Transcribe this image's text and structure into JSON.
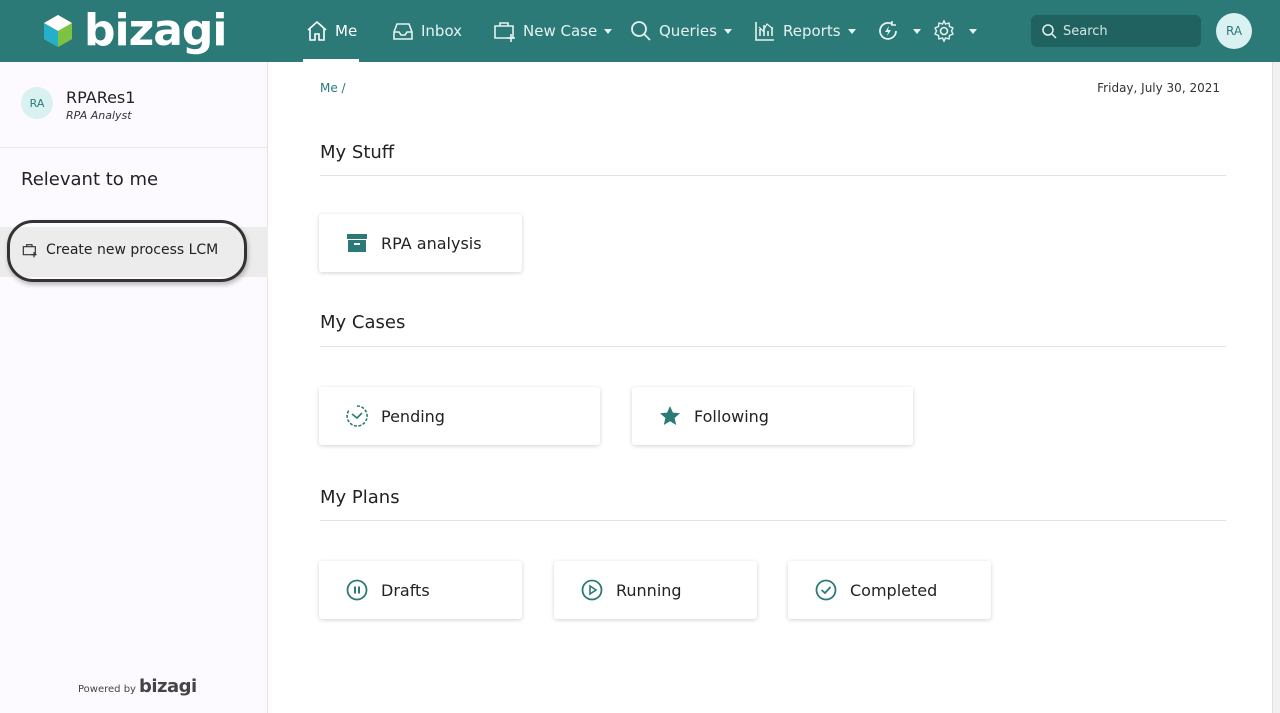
{
  "brand": {
    "name": "bizagi",
    "powered_prefix": "Powered by",
    "powered_brand": "bizagi"
  },
  "colors": {
    "primary": "#2b7a78",
    "accent": "#1f6260",
    "avatar_bg": "#d9f1f1"
  },
  "nav": {
    "items": [
      {
        "label": "Me",
        "icon": "home-icon",
        "active": true
      },
      {
        "label": "Inbox",
        "icon": "inbox-icon"
      },
      {
        "label": "New Case",
        "icon": "new-case-icon",
        "dropdown": true
      },
      {
        "label": "Queries",
        "icon": "search-icon",
        "dropdown": true
      },
      {
        "label": "Reports",
        "icon": "reports-icon",
        "dropdown": true
      },
      {
        "label": "",
        "icon": "automation-icon",
        "dropdown": true
      },
      {
        "label": "",
        "icon": "gear-icon",
        "dropdown": true
      }
    ],
    "search_placeholder": "Search",
    "avatar_initials": "RA"
  },
  "sidebar": {
    "user": {
      "initials": "RA",
      "name": "RPARes1",
      "role": "RPA Analyst"
    },
    "relevant_title": "Relevant to me",
    "create_item": {
      "label": "Create new process LCM",
      "icon": "new-case-icon"
    }
  },
  "main": {
    "breadcrumb": "Me /",
    "date": "Friday, July 30, 2021",
    "sections": [
      {
        "title": "My Stuff",
        "cards": [
          {
            "label": "RPA analysis",
            "icon": "archive-icon"
          }
        ]
      },
      {
        "title": "My Cases",
        "cards": [
          {
            "label": "Pending",
            "icon": "timer-icon"
          },
          {
            "label": "Following",
            "icon": "star-icon"
          }
        ]
      },
      {
        "title": "My Plans",
        "cards": [
          {
            "label": "Drafts",
            "icon": "pause-circle-icon"
          },
          {
            "label": "Running",
            "icon": "play-circle-icon"
          },
          {
            "label": "Completed",
            "icon": "check-circle-icon"
          }
        ]
      }
    ]
  }
}
